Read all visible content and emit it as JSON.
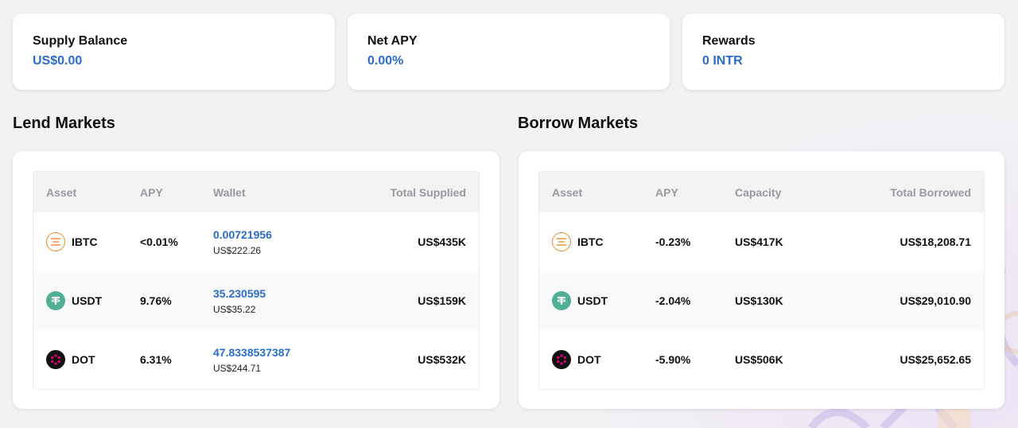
{
  "summary": {
    "supply_balance": {
      "title": "Supply Balance",
      "value": "US$0.00"
    },
    "net_apy": {
      "title": "Net APY",
      "value": "0.00%"
    },
    "rewards": {
      "title": "Rewards",
      "value": "0 INTR"
    }
  },
  "lend": {
    "title": "Lend Markets",
    "headers": {
      "asset": "Asset",
      "apy": "APY",
      "wallet": "Wallet",
      "total": "Total Supplied"
    },
    "rows": [
      {
        "icon": "ibtc-icon",
        "asset": "IBTC",
        "apy": "<0.01%",
        "wallet_amount": "0.00721956",
        "wallet_usd": "US$222.26",
        "total": "US$435K"
      },
      {
        "icon": "usdt-icon",
        "asset": "USDT",
        "apy": "9.76%",
        "wallet_amount": "35.230595",
        "wallet_usd": "US$35.22",
        "total": "US$159K"
      },
      {
        "icon": "dot-icon",
        "asset": "DOT",
        "apy": "6.31%",
        "wallet_amount": "47.8338537387",
        "wallet_usd": "US$244.71",
        "total": "US$532K"
      }
    ]
  },
  "borrow": {
    "title": "Borrow Markets",
    "headers": {
      "asset": "Asset",
      "apy": "APY",
      "capacity": "Capacity",
      "total": "Total Borrowed"
    },
    "rows": [
      {
        "icon": "ibtc-icon",
        "asset": "IBTC",
        "apy": "-0.23%",
        "capacity": "US$417K",
        "total": "US$18,208.71"
      },
      {
        "icon": "usdt-icon",
        "asset": "USDT",
        "apy": "-2.04%",
        "capacity": "US$130K",
        "total": "US$29,010.90"
      },
      {
        "icon": "dot-icon",
        "asset": "DOT",
        "apy": "-5.90%",
        "capacity": "US$506K",
        "total": "US$25,652.65"
      }
    ]
  },
  "colors": {
    "accent": "#2a6cc7",
    "usdt": "#50af95",
    "ibtc": "#f08a2a",
    "dot": "#e6007a"
  }
}
